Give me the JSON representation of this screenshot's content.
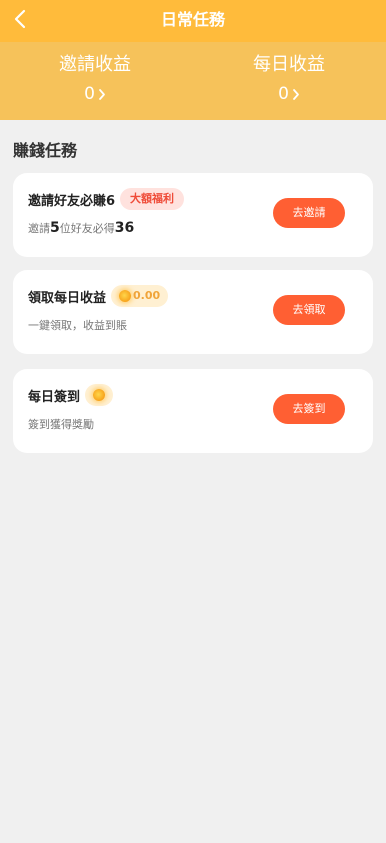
{
  "header": {
    "title": "日常任務",
    "back_icon": "chevron-left-icon"
  },
  "earnings": {
    "invite": {
      "label": "邀請收益",
      "value": "0"
    },
    "daily": {
      "label": "每日收益",
      "value": "0"
    }
  },
  "section_title": "賺錢任務",
  "tasks": [
    {
      "title": "邀請好友必賺6",
      "badge": "大額福利",
      "desc_prefix": "邀請",
      "desc_num1": "5",
      "desc_mid": "位好友必得",
      "desc_num2": "36",
      "button": "去邀請"
    },
    {
      "title": "領取每日收益",
      "badge_amount": "0.00",
      "desc": "一鍵領取，收益到賬",
      "button": "去領取"
    },
    {
      "title": "每日簽到",
      "desc": "簽到獲得獎勵",
      "button": "去簽到"
    }
  ],
  "colors": {
    "header": "#ffbb3b",
    "earnings_bg": "#f6c25a",
    "button": "#ff5f33",
    "badge_red_bg": "#ffe2de",
    "badge_red_text": "#ef4b38",
    "coin_badge_bg": "#fff0d2"
  }
}
